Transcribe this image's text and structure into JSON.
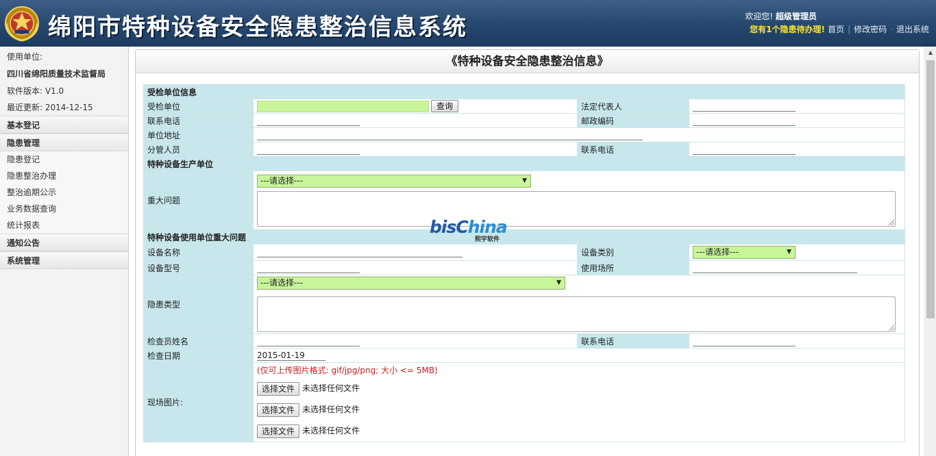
{
  "header": {
    "title": "绵阳市特种设备安全隐患整治信息系统",
    "welcome_prefix": "欢迎您!",
    "user": "超级管理员",
    "alert": "您有1个隐患待办理!",
    "links": [
      "首页",
      "修改密码",
      "退出系统"
    ]
  },
  "sidebar": {
    "unit_label": "使用单位:",
    "unit_name": "四川省绵阳质量技术监督局",
    "version": "软件版本: V1.0",
    "updated": "最近更新: 2014-12-15",
    "menu": {
      "basic": "基本登记",
      "hazard": "隐患管理",
      "hazard_items": [
        "隐患登记",
        "隐患整治办理",
        "整治逾期公示",
        "业务数据查询",
        "统计报表"
      ],
      "notice": "通知公告",
      "system": "系统管理"
    }
  },
  "form": {
    "title": "《特种设备安全隐患整治信息》",
    "sec1": "受检单位信息",
    "inspected_unit": "受检单位",
    "query_btn": "查询",
    "legal_rep": "法定代表人",
    "phone": "联系电话",
    "postcode": "邮政编码",
    "address": "单位地址",
    "staff": "分管人员",
    "phone2": "联系电话",
    "sec2": "特种设备生产单位",
    "major_issue": "重大问题",
    "select_placeholder": "---请选择---",
    "sec3": "特种设备使用单位重大问题",
    "device_name": "设备名称",
    "device_category": "设备类别",
    "device_model": "设备型号",
    "use_place": "使用场所",
    "hazard_type": "隐患类型",
    "inspector_name": "检查员姓名",
    "phone3": "联系电话",
    "inspect_date": "检查日期",
    "inspect_date_value": "2015-01-19",
    "photo_hint": "(仅可上传图片格式: gif/jpg/png; 大小 <= 5MB)",
    "photos": "现场图片:",
    "file_btn": "选择文件",
    "no_file": "未选择任何文件"
  },
  "watermark": {
    "brand": "bischina",
    "sub": "熙宇软件"
  },
  "colors": {
    "header": "#24466d",
    "section": "#c7e7ec",
    "select": "#c9f59a",
    "alert": "#ffe62a",
    "hint": "#c41e1e"
  }
}
